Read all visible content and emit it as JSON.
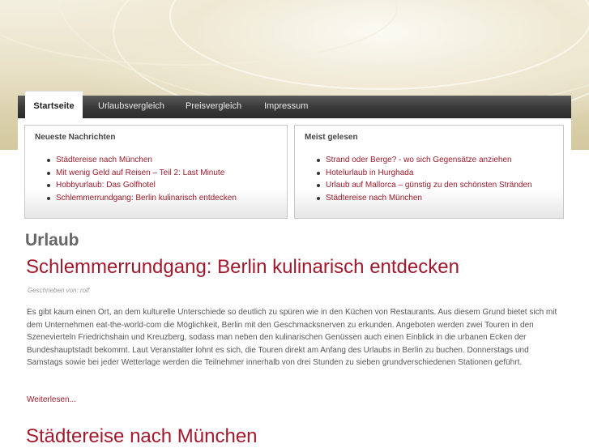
{
  "nav": {
    "tabs": [
      {
        "label": "Startseite",
        "active": true
      },
      {
        "label": "Urlaubsvergleich",
        "active": false
      },
      {
        "label": "Preisvergleich",
        "active": false
      },
      {
        "label": "Impressum",
        "active": false
      }
    ]
  },
  "news_box": {
    "title": "Neueste Nachrichten",
    "items": [
      "Städtereise nach München",
      "Mit wenig Geld auf Reisen – Teil 2: Last Minute",
      "Hobbyurlaub: Das Golfhotel",
      "Schlemmerrundgang: Berlin kulinarisch entdecken"
    ]
  },
  "popular_box": {
    "title": "Meist gelesen",
    "items": [
      "Strand oder Berge? - wo sich Gegensätze anziehen",
      "Hotelurlaub in Hurghada",
      "Urlaub auf Mallorca – günstig zu den schönsten Stränden",
      "Städtereise nach München"
    ]
  },
  "category": "Urlaub",
  "post": {
    "title": "Schlemmerrundgang: Berlin kulinarisch entdecken",
    "byline": "Geschrieben von: rolf",
    "body": "Es gibt kaum einen Ort, an dem kulturelle Unterschiede so deutlich zu spüren wie in den Küchen von Restaurants. Aus diesem Grund bietet sich mit dem Unternehmen eat-the-world-com die Möglichkeit, Berlin mit den Geschmacksnerven zu erkunden. Angeboten werden zwei Touren in den Szenevierteln Friedrichshain und Kreuzberg, sodass man neben den kulinarischen Genüssen auch einen Einblick in die urbanen Ecken der Bundeshauptstadt bekommt. Laut Veranstalter lohnt es sich, die Touren direkt am Anfang des Urlaubs in Berlin zu buchen. Donnerstags und Samstags sowie bei jeder Wetterlage werden die Teilnehmer innerhalb von drei Stunden zu sieben grundverschiedenen Stationen geführt.",
    "read_more": "Weiterlesen..."
  },
  "next_post": {
    "title": "Städtereise nach München"
  },
  "colors": {
    "link": "#9a1c2c",
    "title": "#a3182c",
    "nav_bg": "#3b3b3b",
    "header_bg": "#e9e2c8"
  }
}
